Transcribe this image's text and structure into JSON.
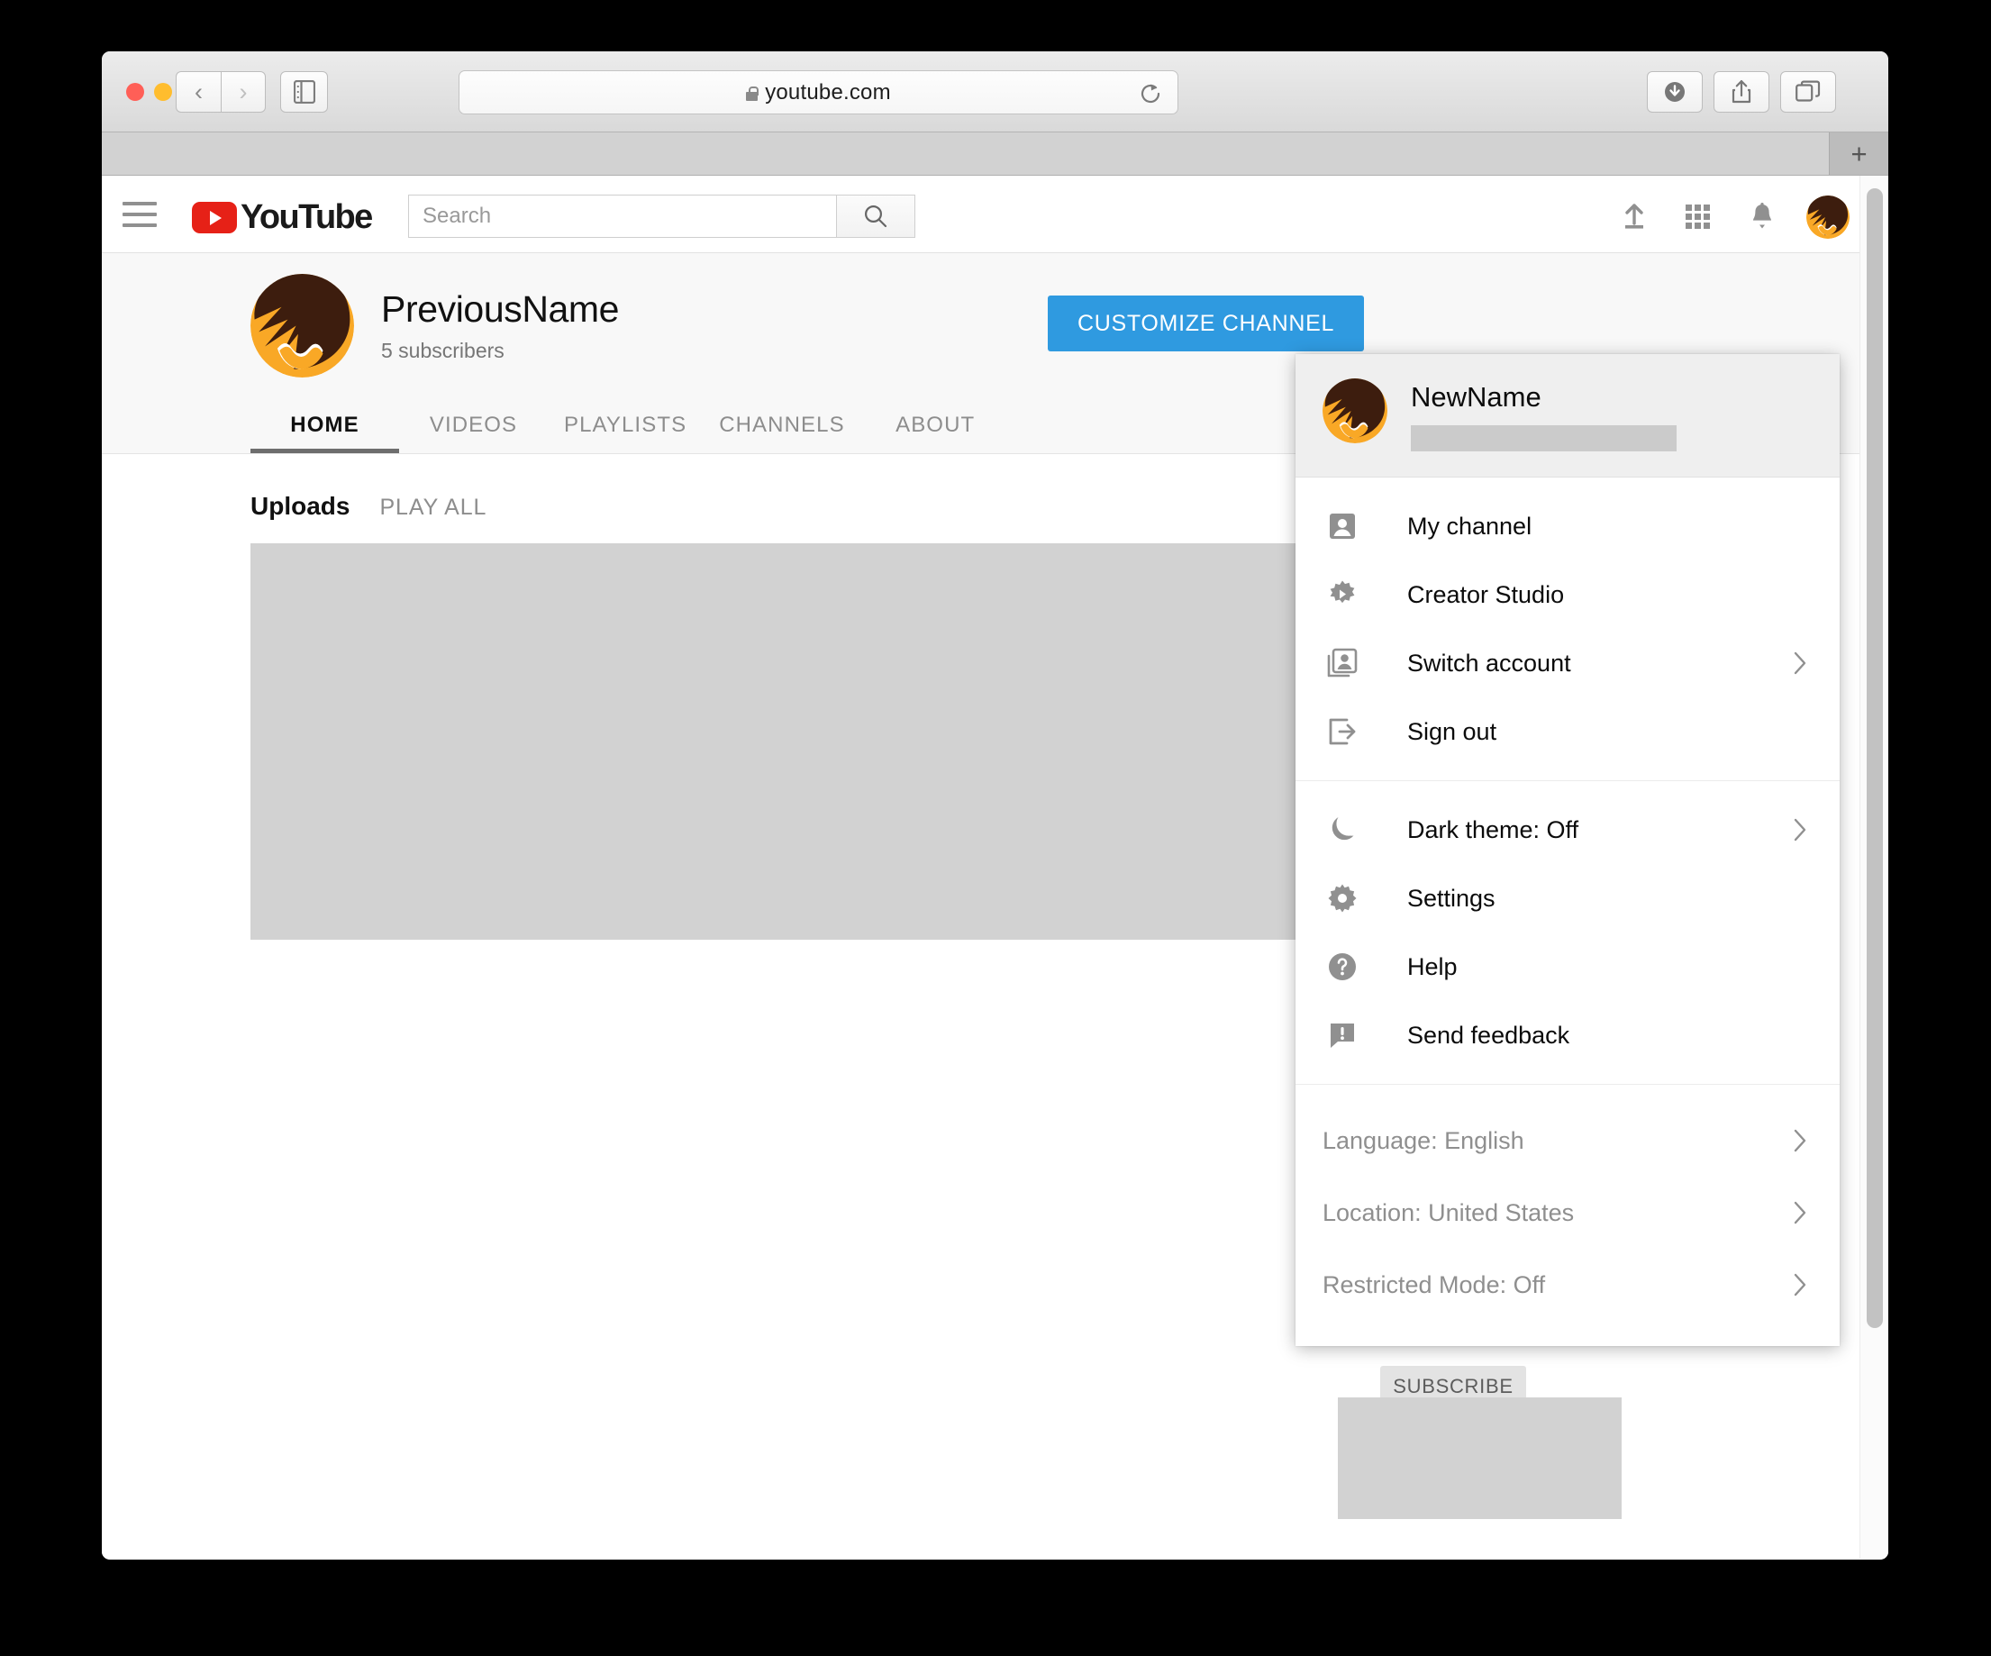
{
  "browser": {
    "address": "youtube.com",
    "traffic_lights": [
      "close",
      "minimize",
      "maximize"
    ],
    "back_label": "‹",
    "forward_label": "›",
    "sidebar_icon": "sidebar-icon",
    "reload_icon": "reload-icon",
    "downloads_icon": "downloads-icon",
    "share_icon": "share-icon",
    "tabs_icon": "tab-overview-icon",
    "new_tab_label": "+"
  },
  "masthead": {
    "logo_text": "YouTube",
    "search_placeholder": "Search",
    "search_value": "",
    "actions": [
      {
        "name": "upload-icon"
      },
      {
        "name": "apps-grid-icon"
      },
      {
        "name": "notifications-bell-icon"
      }
    ]
  },
  "channel": {
    "name": "PreviousName",
    "subscribers": "5 subscribers",
    "customize_label": "CUSTOMIZE CHANNEL",
    "tabs": [
      {
        "label": "HOME",
        "active": true
      },
      {
        "label": "VIDEOS",
        "active": false
      },
      {
        "label": "PLAYLISTS",
        "active": false
      },
      {
        "label": "CHANNELS",
        "active": false
      },
      {
        "label": "ABOUT",
        "active": false
      }
    ]
  },
  "shelf": {
    "title": "Uploads",
    "play_all": "PLAY ALL",
    "subscribe_label": "SUBSCRIBE"
  },
  "account_menu": {
    "name": "NewName",
    "email_redacted": true,
    "groups": [
      {
        "items": [
          {
            "label": "My channel",
            "icon": "person-card-icon",
            "arrow": false
          },
          {
            "label": "Creator Studio",
            "icon": "gear-play-icon",
            "arrow": false
          },
          {
            "label": "Switch account",
            "icon": "switch-account-icon",
            "arrow": true
          },
          {
            "label": "Sign out",
            "icon": "sign-out-icon",
            "arrow": false
          }
        ]
      },
      {
        "items": [
          {
            "label": "Dark theme: Off",
            "icon": "moon-icon",
            "arrow": true
          },
          {
            "label": "Settings",
            "icon": "gear-icon",
            "arrow": false
          },
          {
            "label": "Help",
            "icon": "help-icon",
            "arrow": false
          },
          {
            "label": "Send feedback",
            "icon": "feedback-icon",
            "arrow": false
          }
        ]
      },
      {
        "plain": true,
        "items": [
          {
            "label": "Language: English",
            "arrow": true
          },
          {
            "label": "Location: United States",
            "arrow": true
          },
          {
            "label": "Restricted Mode: Off",
            "arrow": true
          }
        ]
      }
    ]
  },
  "colors": {
    "brand_red": "#e62117",
    "accent_blue": "#2f9ae0",
    "avatar_orange": "#f7a325",
    "placeholder_gray": "#d2d2d2"
  }
}
